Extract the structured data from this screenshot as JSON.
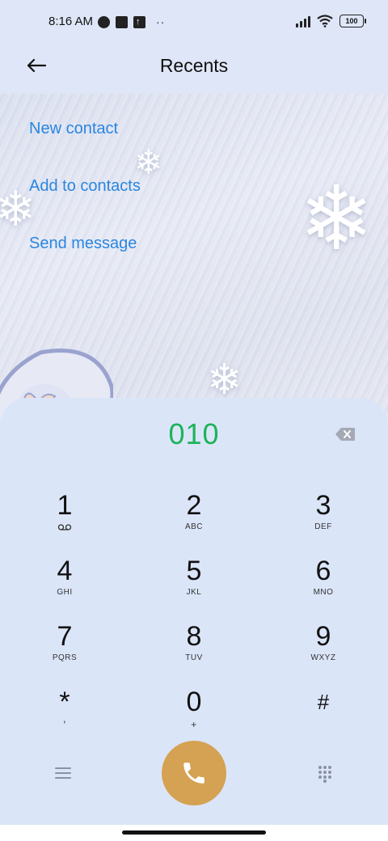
{
  "status_bar": {
    "time": "8:16 AM",
    "battery": "100",
    "icons": [
      "signal-icon",
      "wifi-icon",
      "battery-icon"
    ]
  },
  "header": {
    "title": "Recents"
  },
  "actions": [
    {
      "label": "New contact"
    },
    {
      "label": "Add to contacts"
    },
    {
      "label": "Send message"
    }
  ],
  "dialer": {
    "number": "010",
    "keys": [
      {
        "digit": "1",
        "letters": ""
      },
      {
        "digit": "2",
        "letters": "ABC"
      },
      {
        "digit": "3",
        "letters": "DEF"
      },
      {
        "digit": "4",
        "letters": "GHI"
      },
      {
        "digit": "5",
        "letters": "JKL"
      },
      {
        "digit": "6",
        "letters": "MNO"
      },
      {
        "digit": "7",
        "letters": "PQRS"
      },
      {
        "digit": "8",
        "letters": "TUV"
      },
      {
        "digit": "9",
        "letters": "WXYZ"
      },
      {
        "digit": "*",
        "letters": ","
      },
      {
        "digit": "0",
        "letters": "+"
      },
      {
        "digit": "#",
        "letters": ""
      }
    ]
  },
  "colors": {
    "accent_link": "#2a86df",
    "number_green": "#1db35a",
    "call_button": "#d4a252",
    "background": "#dfe6f7"
  }
}
